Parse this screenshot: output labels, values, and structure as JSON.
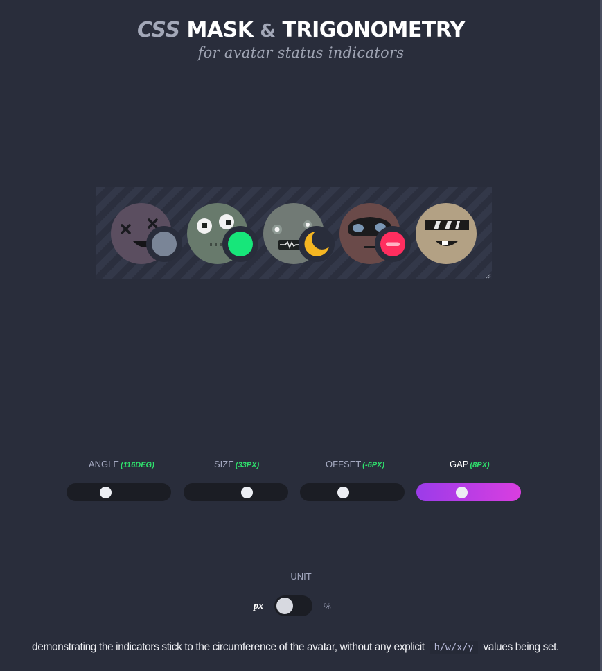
{
  "header": {
    "title_css": "CSS",
    "title_mask": "MASK",
    "title_amp": "&",
    "title_trig": "TRIGONOMETRY",
    "subtitle": "for avatar status indicators"
  },
  "avatars": [
    {
      "face": "dead",
      "status": "offline",
      "status_color": "#7a8597"
    },
    {
      "face": "surprised",
      "status": "online",
      "status_color": "#17e67a"
    },
    {
      "face": "robot",
      "status": "away",
      "status_color": "#f5b622"
    },
    {
      "face": "masked",
      "status": "do-not-disturb",
      "status_color": "#ff2e5f"
    },
    {
      "face": "cool",
      "status": "none",
      "status_color": ""
    }
  ],
  "controls": [
    {
      "label": "ANGLE",
      "value": "(116deg)",
      "fill": 0.35
    },
    {
      "label": "SIZE",
      "value": "(33px)",
      "fill": 0.63
    },
    {
      "label": "OFFSET",
      "value": "(-6px)",
      "fill": 0.4
    },
    {
      "label": "GAP",
      "value": "(8px)",
      "fill": 0.42,
      "active": true
    }
  ],
  "unit": {
    "label": "UNIT",
    "option_left": "px",
    "option_right": "%",
    "selected": "px"
  },
  "footer": {
    "text_before": "demonstrating the indicators stick to the circumference of the avatar, without any explicit",
    "code": "h/w/x/y",
    "text_after": "values being set."
  },
  "colors": {
    "background": "#292d3b",
    "slider_track": "#1b1d24",
    "active_gradient_start": "#9b3ce9",
    "active_gradient_end": "#d93ee0",
    "value_accent": "#2fe06c"
  }
}
